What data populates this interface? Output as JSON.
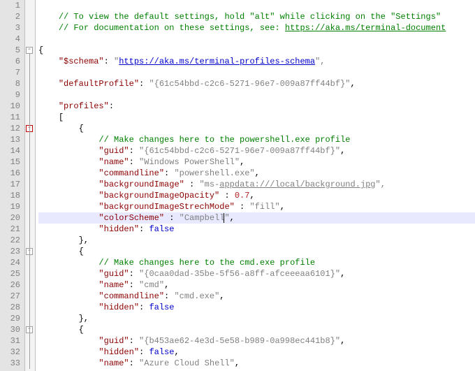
{
  "lines": [
    {
      "n": 1
    },
    {
      "n": 2,
      "c": "comment",
      "i": 1,
      "t": "// To view the default settings, hold \"alt\" while clicking on the \"Settings\" "
    },
    {
      "n": 3,
      "c": "comment_link",
      "i": 1,
      "pre": "// For documentation on these settings, see: ",
      "link": "https://aka.ms/terminal-document"
    },
    {
      "n": 4
    },
    {
      "n": 5,
      "c": "punct",
      "i": 0,
      "t": "{",
      "fold": "minus"
    },
    {
      "n": 6,
      "c": "kv_link",
      "i": 1,
      "k": "\"$schema\"",
      "sep": ": ",
      "q": "\"",
      "link": "https://aka.ms/terminal-profiles-schema",
      "tail": "\","
    },
    {
      "n": 7
    },
    {
      "n": 8,
      "c": "kv",
      "i": 1,
      "k": "\"defaultProfile\"",
      "sep": ": ",
      "v": "\"{61c54bbd-c2c6-5271-96e7-009a87ff44bf}\"",
      "tail": ","
    },
    {
      "n": 9
    },
    {
      "n": 10,
      "c": "keyonly",
      "i": 1,
      "k": "\"profiles\"",
      "tail": ":"
    },
    {
      "n": 11,
      "c": "punct",
      "i": 1,
      "t": "["
    },
    {
      "n": 12,
      "c": "punct",
      "i": 2,
      "t": "{",
      "fold": "minus_red"
    },
    {
      "n": 13,
      "c": "comment",
      "i": 3,
      "t": "// Make changes here to the powershell.exe profile"
    },
    {
      "n": 14,
      "c": "kv",
      "i": 3,
      "k": "\"guid\"",
      "sep": ": ",
      "v": "\"{61c54bbd-c2c6-5271-96e7-009a87ff44bf}\"",
      "tail": ","
    },
    {
      "n": 15,
      "c": "kv",
      "i": 3,
      "k": "\"name\"",
      "sep": ": ",
      "v": "\"Windows PowerShell\"",
      "tail": ","
    },
    {
      "n": 16,
      "c": "kv",
      "i": 3,
      "k": "\"commandline\"",
      "sep": ": ",
      "v": "\"powershell.exe\"",
      "tail": ","
    },
    {
      "n": 17,
      "c": "kv_partlink",
      "i": 3,
      "k": "\"backgroundImage\"",
      "sep": " : ",
      "q": "\"",
      "plain": "ms-",
      "link": "appdata:///local/background.jpg",
      "tail": "\","
    },
    {
      "n": 18,
      "c": "kv_num",
      "i": 3,
      "k": "\"backgroundImageOpacity\"",
      "sep": " : ",
      "v": "0.7",
      "tail": ","
    },
    {
      "n": 19,
      "c": "kv",
      "i": 3,
      "k": "\"backgroundImageStrechMode\"",
      "sep": " : ",
      "v": "\"fill\"",
      "tail": ","
    },
    {
      "n": 20,
      "c": "kv_caret",
      "i": 3,
      "k": "\"colorScheme\"",
      "sep": " : ",
      "pre": "\"Campbell",
      "post": "\"",
      "tail": ",",
      "hl": true
    },
    {
      "n": 21,
      "c": "kv_kw",
      "i": 3,
      "k": "\"hidden\"",
      "sep": ": ",
      "v": "false"
    },
    {
      "n": 22,
      "c": "punct",
      "i": 2,
      "t": "},"
    },
    {
      "n": 23,
      "c": "punct",
      "i": 2,
      "t": "{",
      "fold": "minus"
    },
    {
      "n": 24,
      "c": "comment",
      "i": 3,
      "t": "// Make changes here to the cmd.exe profile"
    },
    {
      "n": 25,
      "c": "kv",
      "i": 3,
      "k": "\"guid\"",
      "sep": ": ",
      "v": "\"{0caa0dad-35be-5f56-a8ff-afceeeaa6101}\"",
      "tail": ","
    },
    {
      "n": 26,
      "c": "kv",
      "i": 3,
      "k": "\"name\"",
      "sep": ": ",
      "v": "\"cmd\"",
      "tail": ","
    },
    {
      "n": 27,
      "c": "kv",
      "i": 3,
      "k": "\"commandline\"",
      "sep": ": ",
      "v": "\"cmd.exe\"",
      "tail": ","
    },
    {
      "n": 28,
      "c": "kv_kw",
      "i": 3,
      "k": "\"hidden\"",
      "sep": ": ",
      "v": "false"
    },
    {
      "n": 29,
      "c": "punct",
      "i": 2,
      "t": "},"
    },
    {
      "n": 30,
      "c": "punct",
      "i": 2,
      "t": "{",
      "fold": "minus"
    },
    {
      "n": 31,
      "c": "kv",
      "i": 3,
      "k": "\"guid\"",
      "sep": ": ",
      "v": "\"{b453ae62-4e3d-5e58-b989-0a998ec441b8}\"",
      "tail": ","
    },
    {
      "n": 32,
      "c": "kv_kw",
      "i": 3,
      "k": "\"hidden\"",
      "sep": ": ",
      "v": "false",
      "tail": ","
    },
    {
      "n": 33,
      "c": "kv",
      "i": 3,
      "k": "\"name\"",
      "sep": ": ",
      "v": "\"Azure Cloud Shell\"",
      "tail": ","
    }
  ],
  "indentUnit": "    "
}
